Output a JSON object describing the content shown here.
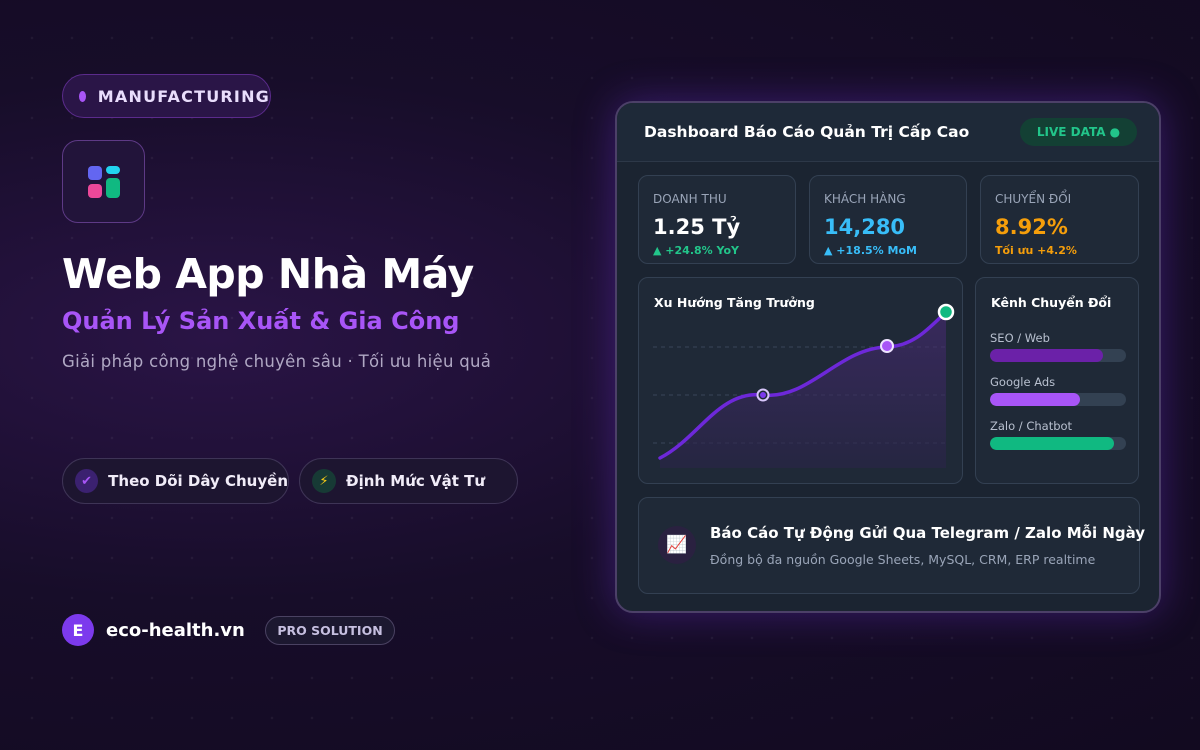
{
  "hero": {
    "badge": "MANUFACTURING",
    "title": "Web App Nhà Máy",
    "subtitle": "Quản Lý Sản Xuất & Gia Công",
    "tagline": "Giải pháp công nghệ chuyên sâu · Tối ưu hiệu quả",
    "features": [
      {
        "label": "Theo Dõi Dây Chuyền",
        "icon": "check-icon"
      },
      {
        "label": "Định Mức Vật Tư",
        "icon": "lightning-icon"
      }
    ],
    "brand_initial": "E",
    "brand_name": "eco-health.vn",
    "pro_badge": "PRO SOLUTION"
  },
  "dashboard": {
    "title": "Dashboard Báo Cáo Quản Trị Cấp Cao",
    "live_label": "LIVE DATA ●",
    "kpis": [
      {
        "label": "DOANH THU",
        "value": "1.25 Tỷ",
        "delta": "▲ +24.8% YoY",
        "value_color": "#ffffff",
        "delta_color": "#22c58a"
      },
      {
        "label": "KHÁCH HÀNG",
        "value": "14,280",
        "delta": "▲ +18.5% MoM",
        "value_color": "#38bdf8",
        "delta_color": "#38bdf8"
      },
      {
        "label": "CHUYỂN ĐỔI",
        "value": "8.92%",
        "delta": "Tối ưu +4.2%",
        "value_color": "#f59e0b",
        "delta_color": "#f59e0b"
      }
    ],
    "trend": {
      "title": "Xu Hướng Tăng Trưởng"
    },
    "channels": {
      "title": "Kênh Chuyển Đổi",
      "items": [
        {
          "label": "SEO / Web",
          "percent": 83,
          "color": "#6b21a8"
        },
        {
          "label": "Google Ads",
          "percent": 66,
          "color": "#a855f7"
        },
        {
          "label": "Zalo / Chatbot",
          "percent": 91,
          "color": "#10b981"
        }
      ]
    },
    "report": {
      "icon": "chart-up-icon",
      "title": "Báo Cáo Tự Động Gửi Qua Telegram / Zalo Mỗi Ngày",
      "subtitle": "Đồng bộ đa nguồn Google Sheets, MySQL, CRM, ERP realtime"
    }
  },
  "colors": {
    "accent": "#a855f7",
    "success": "#10b981",
    "info": "#38bdf8",
    "warning": "#f59e0b"
  }
}
